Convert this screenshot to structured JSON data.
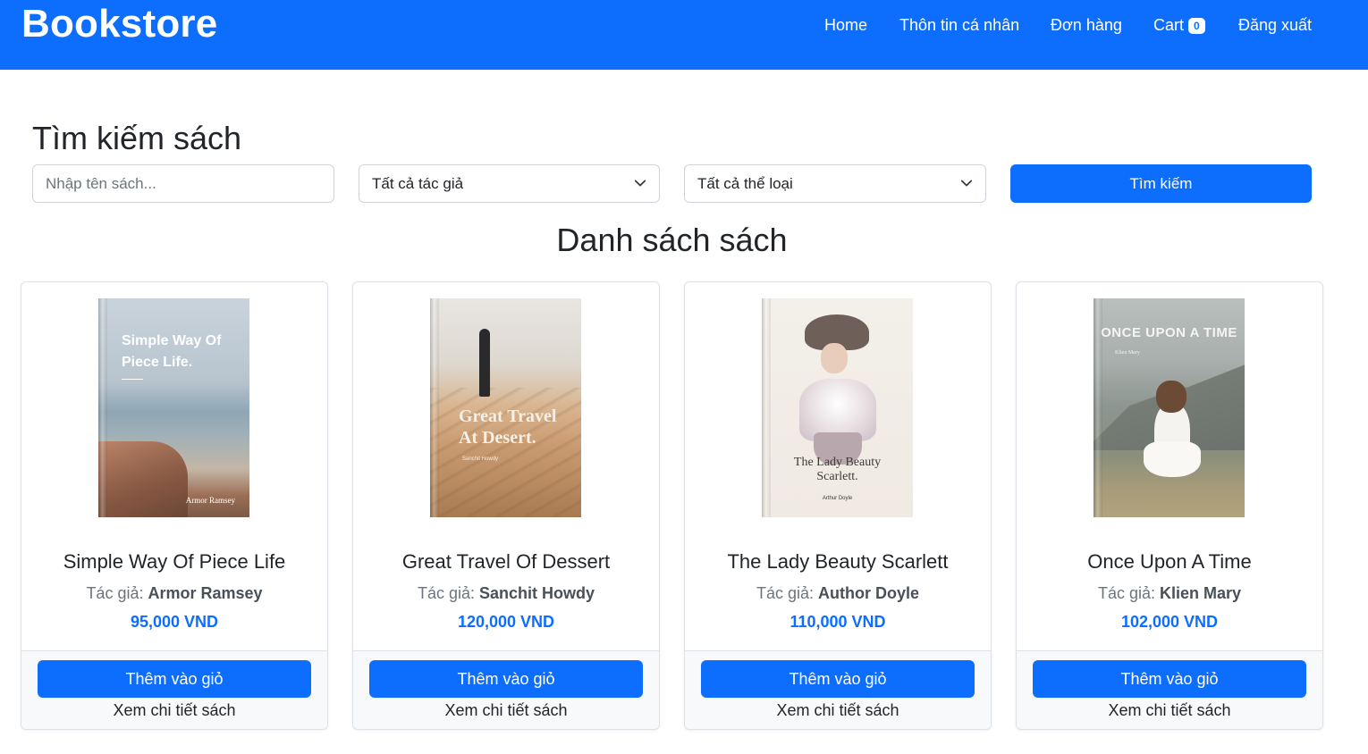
{
  "navbar": {
    "brand": "Bookstore",
    "items": [
      "Home",
      "Thôn tin cá nhân",
      "Đơn hàng",
      "Cart",
      "Đăng xuất"
    ],
    "cart_count": "0",
    "color": "#0d6efd"
  },
  "search": {
    "title": "Tìm kiếm sách",
    "placeholder": "Nhập tên sách...",
    "value": "",
    "author_selected": "Tất cả tác giả",
    "category_selected": "Tất cả thể loại",
    "button_label": "Tìm kiếm"
  },
  "list": {
    "title": "Danh sách sách",
    "author_prefix": "Tác giả:",
    "add_label": "Thêm vào giỏ",
    "detail_label": "Xem chi tiết sách",
    "books": [
      {
        "title": "Simple Way Of Piece Life",
        "author": "Armor Ramsey",
        "price": "95,000 VND",
        "cover_lines": [
          "Simple Way Of",
          "Piece Life."
        ],
        "cover_author": "Armor Ramsey"
      },
      {
        "title": "Great Travel Of Dessert",
        "author": "Sanchit Howdy",
        "price": "120,000 VND",
        "cover_lines": [
          "Great Travel",
          "At Desert."
        ],
        "cover_author": "Sanchit Howdy"
      },
      {
        "title": "The Lady Beauty Scarlett",
        "author": "Author Doyle",
        "price": "110,000 VND",
        "cover_lines": [
          "The Lady Beauty",
          "Scarlett."
        ],
        "cover_author": "Arthur Doyle"
      },
      {
        "title": "Once Upon A Time",
        "author": "Klien Mary",
        "price": "102,000 VND",
        "cover_lines": [
          "ONCE UPON A TIME"
        ],
        "cover_author": "Klien Mary"
      }
    ]
  }
}
